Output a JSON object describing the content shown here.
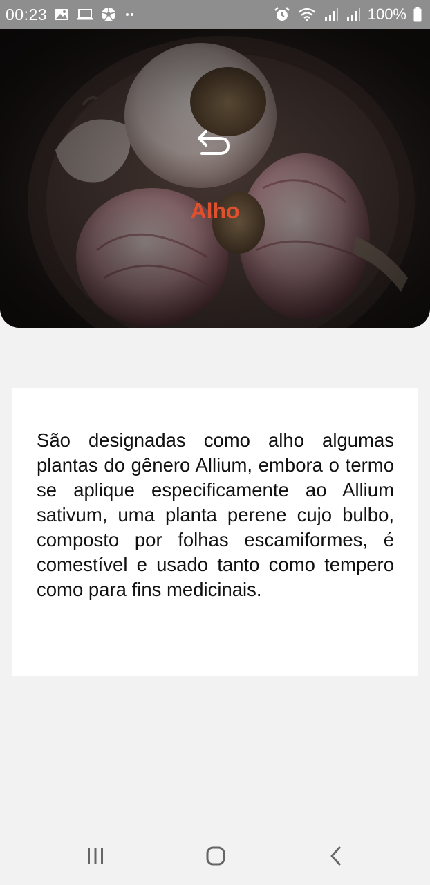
{
  "status_bar": {
    "time": "00:23",
    "battery": "100%",
    "left_icons": [
      "image-icon",
      "laptop-icon",
      "soccer-ball-icon",
      "more-dots-icon"
    ],
    "right_icons": [
      "alarm-icon",
      "wifi-icon",
      "signal-icon",
      "signal-icon",
      "battery-icon"
    ]
  },
  "hero": {
    "title": "Alho",
    "back_icon": "undo-arrow-icon",
    "title_color": "#e0502e"
  },
  "card": {
    "description": "São designadas como alho algumas plantas do gênero Allium, embora o termo se aplique especificamente ao Allium sativum, uma planta perene cujo bulbo, composto por folhas escamiformes, é comestível e usado tanto como tempero como para fins medicinais."
  },
  "nav_bar": {
    "recents_icon": "recents-icon",
    "home_icon": "home-icon",
    "back_icon": "back-chevron-icon"
  }
}
